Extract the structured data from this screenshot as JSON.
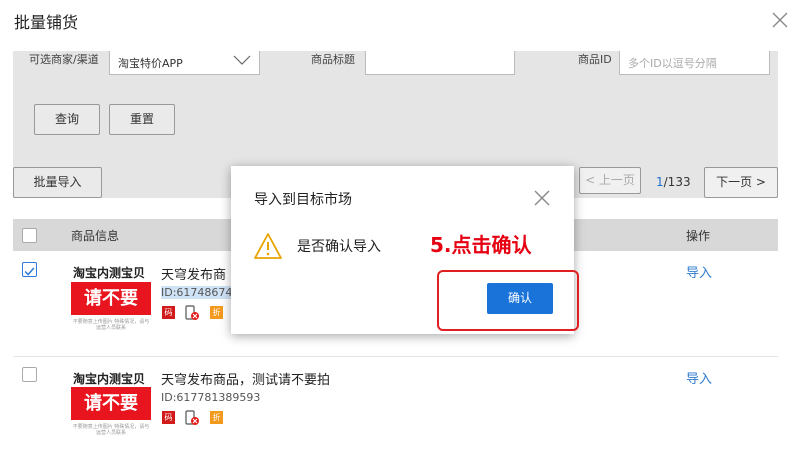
{
  "dialog": {
    "title": "批量铺货"
  },
  "filters": {
    "channel_label": "可选商家/渠道",
    "channel_value": "淘宝特价APP",
    "title_label": "商品标题",
    "title_value": "",
    "id_label": "商品ID",
    "id_placeholder": "多个ID以逗号分隔",
    "query_button": "查询",
    "reset_button": "重置"
  },
  "toolbar": {
    "batch_import_button": "批量导入",
    "prev_page": "< 上一页",
    "page_current": "1",
    "page_total": "/133",
    "next_page": "下一页 >"
  },
  "table": {
    "headers": {
      "product_info": "商品信息",
      "operation": "操作"
    },
    "rows": [
      {
        "checked": true,
        "shop": "淘宝内测宝贝",
        "promo_text": "请不要拍!",
        "promo_sub": "不要随意上传图片 特殊情况，请与运营人员联系",
        "title": "天穹发布商",
        "id": "ID:61748674",
        "tags": [
          "码",
          "折"
        ],
        "action": "导入"
      },
      {
        "checked": false,
        "shop": "淘宝内测宝贝",
        "promo_text": "请不要拍!",
        "promo_sub": "不要随意上传图片 特殊情况，请与运营人员联系",
        "title": "天穹发布商品，测试请不要拍",
        "id": "ID:617781389593",
        "tags": [
          "码",
          "折"
        ],
        "action": "导入"
      }
    ]
  },
  "modal": {
    "title": "导入到目标市场",
    "message": "是否确认导入",
    "confirm_button": "确认",
    "annotation": "5.点击确认"
  },
  "colors": {
    "accent": "#1a73d9",
    "annotation_red": "#e60012",
    "link": "#2e7bd0"
  }
}
